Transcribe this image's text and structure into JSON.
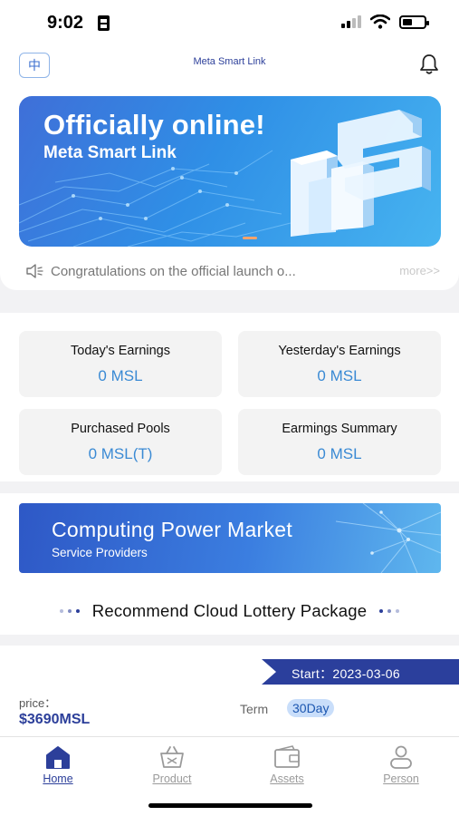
{
  "status_bar": {
    "time": "9:02",
    "battery_level": 0.45
  },
  "header": {
    "language_label": "中",
    "app_title": "Meta Smart Link",
    "bell_icon": "bell-icon"
  },
  "banner": {
    "title": "Officially online!",
    "subtitle": "Meta Smart Link"
  },
  "notice": {
    "icon": "speaker-icon",
    "text": "Congratulations on the official launch o...",
    "more_label": "more>>"
  },
  "stats": [
    {
      "label": "Today's Earnings",
      "value": "0 MSL"
    },
    {
      "label": "Yesterday's Earnings",
      "value": "0 MSL"
    },
    {
      "label": "Purchased Pools",
      "value": "0 MSL(T)"
    },
    {
      "label": "Earmings Summary",
      "value": "0 MSL"
    }
  ],
  "market_banner": {
    "title": "Computing Power Market",
    "subtitle": "Service Providers"
  },
  "section": {
    "title": "Recommend Cloud Lottery Package"
  },
  "package": {
    "start_text": "Start：2023-03-06",
    "price_label": "price：",
    "price_value": "$3690MSL",
    "term_label": "Term",
    "term_value": "30Day"
  },
  "bottom_nav": [
    {
      "label": "Home",
      "icon": "home-icon",
      "active": true
    },
    {
      "label": "Product",
      "icon": "basket-icon",
      "active": false
    },
    {
      "label": "Assets",
      "icon": "wallet-icon",
      "active": false
    },
    {
      "label": "Person",
      "icon": "person-icon",
      "active": false
    }
  ],
  "colors": {
    "accent": "#2c3f9a",
    "stat_value": "#3a8ad4",
    "banner_blue": "#3f6fd8"
  }
}
